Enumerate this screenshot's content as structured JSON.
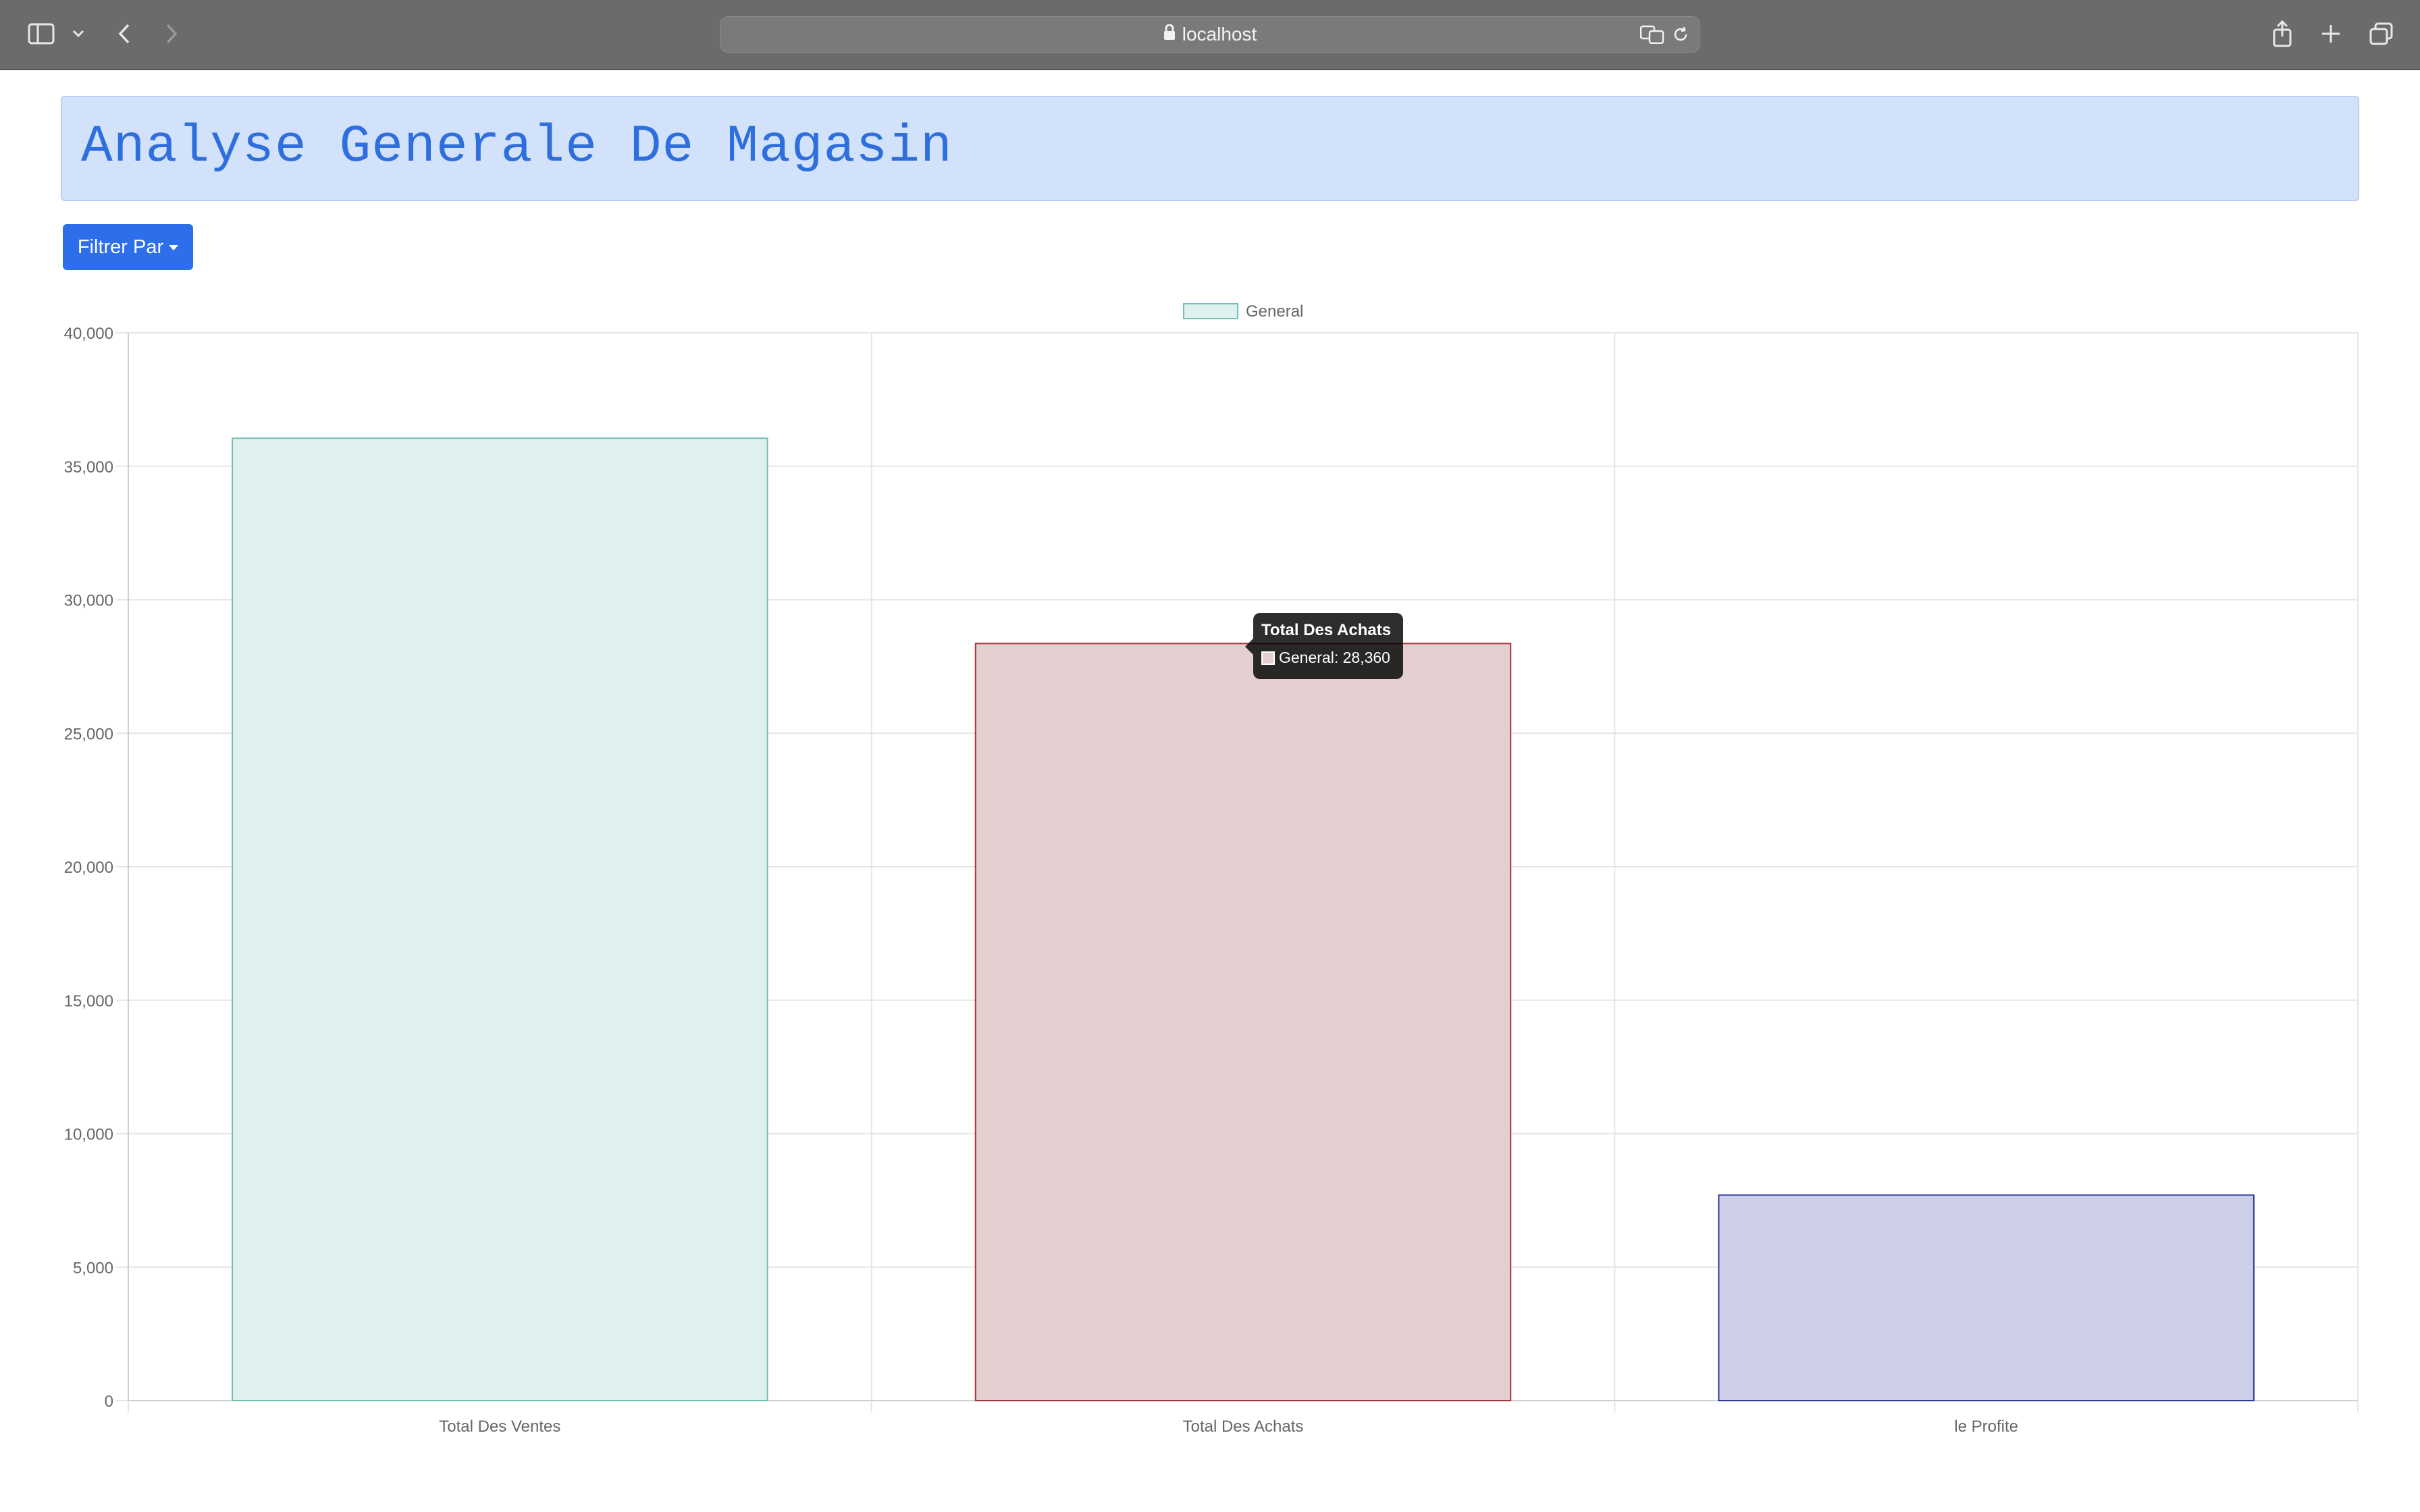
{
  "browser": {
    "url": "localhost",
    "icons": [
      "sidebar-icon",
      "chevron-down-icon",
      "back-icon",
      "forward-icon",
      "lock-icon",
      "translate-icon",
      "reload-icon",
      "share-icon",
      "new-tab-icon",
      "tabs-overview-icon"
    ]
  },
  "header": {
    "title": "Analyse Generale De Magasin"
  },
  "filter": {
    "label": "Filtrer Par"
  },
  "colors": {
    "banner_bg": "#d2e2fb",
    "title": "#2f6fdd",
    "button": "#2d6fea",
    "bar1_fill": "#e0f0ef",
    "bar1_border": "#6fc2b4",
    "bar2_fill": "#e3cfd0",
    "bar2_border": "#a8323a",
    "bar3_fill": "#cdcfe9",
    "bar3_border": "#2e3896"
  },
  "tooltip": {
    "title": "Total Des Achats",
    "label": "General: 28,360"
  },
  "chart_data": {
    "type": "bar",
    "categories": [
      "Total Des Ventes",
      "Total Des Achats",
      "le Profite"
    ],
    "series": [
      {
        "name": "General",
        "values": [
          36050,
          28360,
          7700
        ]
      }
    ],
    "ylim": [
      0,
      40000
    ],
    "yticks": [
      "0",
      "5,000",
      "10,000",
      "15,000",
      "20,000",
      "25,000",
      "30,000",
      "35,000",
      "40,000"
    ],
    "legend": "top",
    "grid": true,
    "xlabel": "",
    "ylabel": ""
  }
}
